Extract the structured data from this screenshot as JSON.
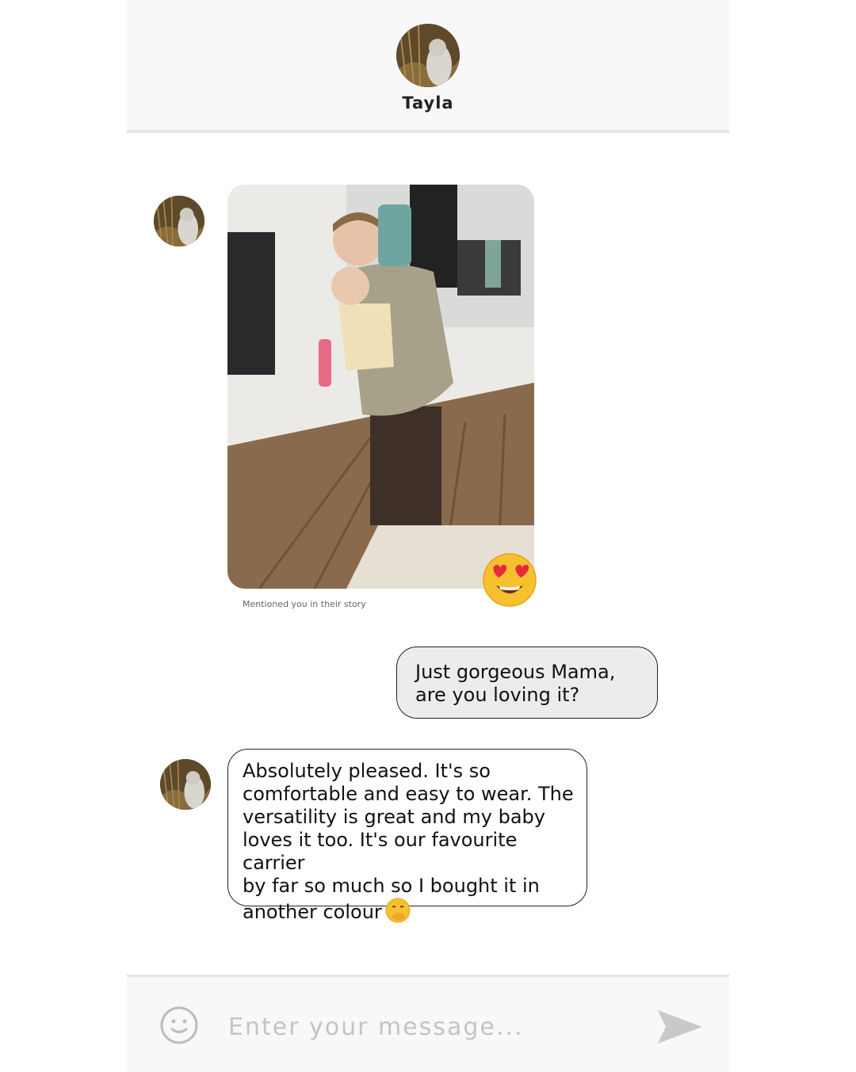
{
  "contact": {
    "name": "Tayla",
    "avatar_icon": "profile-photo"
  },
  "story": {
    "caption": "Mentioned you in their story",
    "reaction_icon": "heart-eyes-emoji"
  },
  "messages": [
    {
      "direction": "outgoing",
      "text": "Just gorgeous Mama,\nare you loving it?"
    },
    {
      "direction": "incoming",
      "text": "Absolutely pleased. It's so\ncomfortable and easy to wear. The\nversatility is great and my baby\nloves it too. It's our favourite carrier\nby far so much so I bought it in\nanother colour",
      "emoji_icon": "hand-over-mouth-emoji"
    }
  ],
  "composer": {
    "placeholder": "Enter your message...",
    "emoji_icon": "smiley-outline-icon",
    "send_icon": "send-arrow-icon"
  },
  "colors": {
    "header_bg": "#f8f8f8",
    "outgoing_bubble": "#ececec",
    "incoming_bubble": "#ffffff",
    "bubble_border": "#222222",
    "divider": "#e6e6e6",
    "send_icon": "#c9c9c9"
  }
}
